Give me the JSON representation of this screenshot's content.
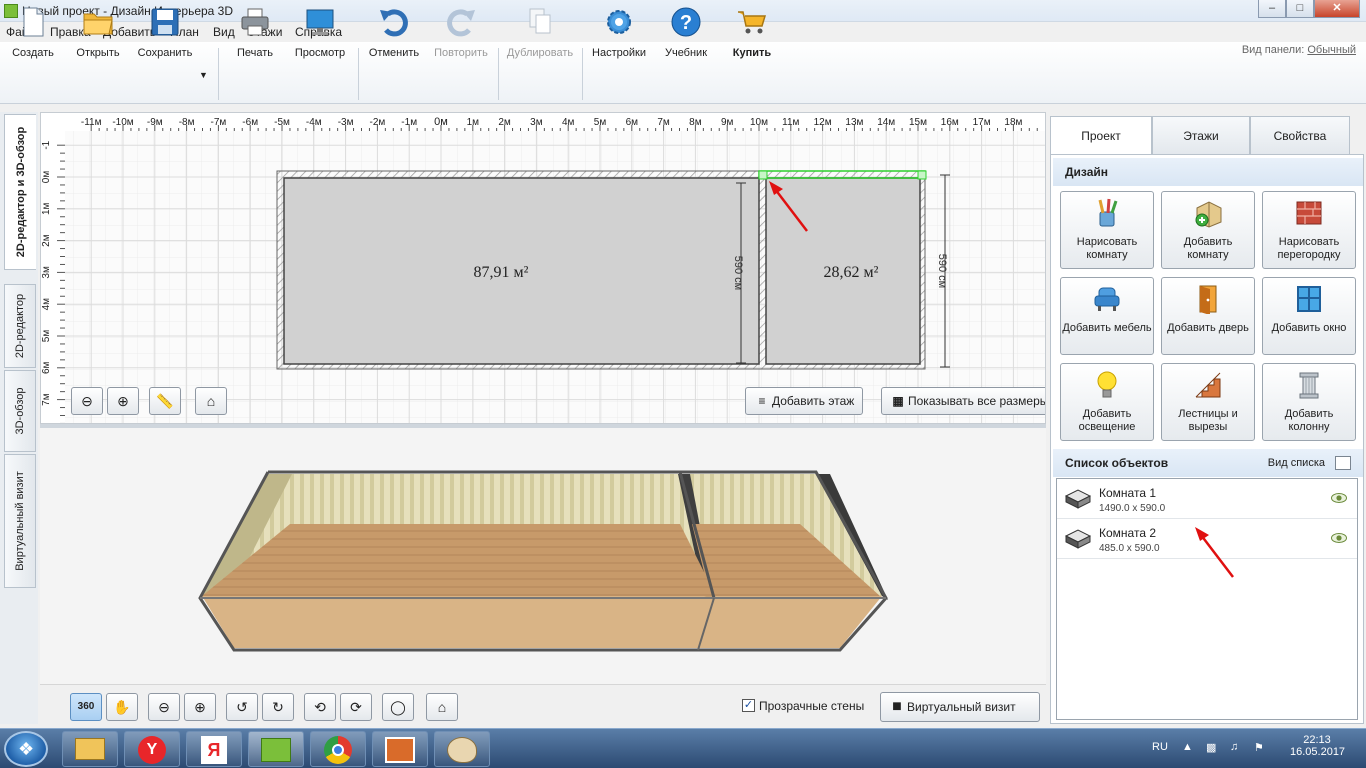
{
  "window": {
    "title": "Новый проект - Дизайн Интерьера 3D"
  },
  "menu": [
    "Файл",
    "Правка",
    "Добавить",
    "План",
    "Вид",
    "Этажи",
    "Справка"
  ],
  "panel_view": {
    "label": "Вид панели:",
    "value": "Обычный"
  },
  "toolbar": [
    {
      "label": "Создать",
      "icon": "new-file-icon"
    },
    {
      "label": "Открыть",
      "icon": "open-folder-icon"
    },
    {
      "label": "Сохранить",
      "icon": "save-disk-icon"
    },
    {
      "label": "Печать",
      "icon": "printer-icon"
    },
    {
      "label": "Просмотр",
      "icon": "monitor-icon"
    },
    {
      "label": "Отменить",
      "icon": "undo-icon"
    },
    {
      "label": "Повторить",
      "icon": "redo-icon",
      "disabled": true
    },
    {
      "label": "Дублировать",
      "icon": "duplicate-icon",
      "disabled": true
    },
    {
      "label": "Настройки",
      "icon": "gear-icon"
    },
    {
      "label": "Учебник",
      "icon": "help-icon"
    },
    {
      "label": "Купить",
      "icon": "cart-icon"
    }
  ],
  "vertical_tabs": [
    "2D-редактор и 3D-обзор",
    "2D-редактор",
    "3D-обзор",
    "Виртуальный визит"
  ],
  "plan": {
    "ruler_x": [
      "-11м",
      "-10м",
      "-9м",
      "-8м",
      "-7м",
      "-6м",
      "-5м",
      "-4м",
      "-3м",
      "-2м",
      "-1м",
      "0м",
      "1м",
      "2м",
      "3м",
      "4м",
      "5м",
      "6м",
      "7м",
      "8м",
      "9м",
      "10м",
      "11м",
      "12м",
      "13м",
      "14м",
      "15м",
      "16м",
      "17м",
      "18м"
    ],
    "ruler_y": [
      "-1",
      "0м",
      "1м",
      "2м",
      "3м",
      "4м",
      "5м",
      "6м",
      "7м"
    ],
    "room1_area": "87,91 м²",
    "room2_area": "28,62 м²",
    "dim1": "590 см",
    "dim2": "590 см",
    "add_floor": "Добавить этаж",
    "show_dims": "Показывать все размеры"
  },
  "view3d": {
    "transparent_walls": "Прозрачные стены",
    "virtual_visit": "Виртуальный визит"
  },
  "right_tabs": [
    "Проект",
    "Этажи",
    "Свойства"
  ],
  "design": {
    "header": "Дизайн",
    "buttons": [
      {
        "label": "Нарисовать комнату",
        "icon": "pencil-cup-icon"
      },
      {
        "label": "Добавить комнату",
        "icon": "room-plus-icon"
      },
      {
        "label": "Нарисовать перегородку",
        "icon": "brick-wall-icon"
      },
      {
        "label": "Добавить мебель",
        "icon": "armchair-icon"
      },
      {
        "label": "Добавить дверь",
        "icon": "door-icon"
      },
      {
        "label": "Добавить окно",
        "icon": "window-icon"
      },
      {
        "label": "Добавить освещение",
        "icon": "bulb-icon"
      },
      {
        "label": "Лестницы и вырезы",
        "icon": "stairs-icon"
      },
      {
        "label": "Добавить колонну",
        "icon": "column-icon"
      }
    ]
  },
  "objects": {
    "header": "Список объектов",
    "view": "Вид списка",
    "items": [
      {
        "name": "Комната 1",
        "dims": "1490.0 x 590.0"
      },
      {
        "name": "Комната 2",
        "dims": "485.0 x 590.0"
      }
    ]
  },
  "taskbar": {
    "lang": "RU",
    "time": "22:13",
    "date": "16.05.2017"
  }
}
